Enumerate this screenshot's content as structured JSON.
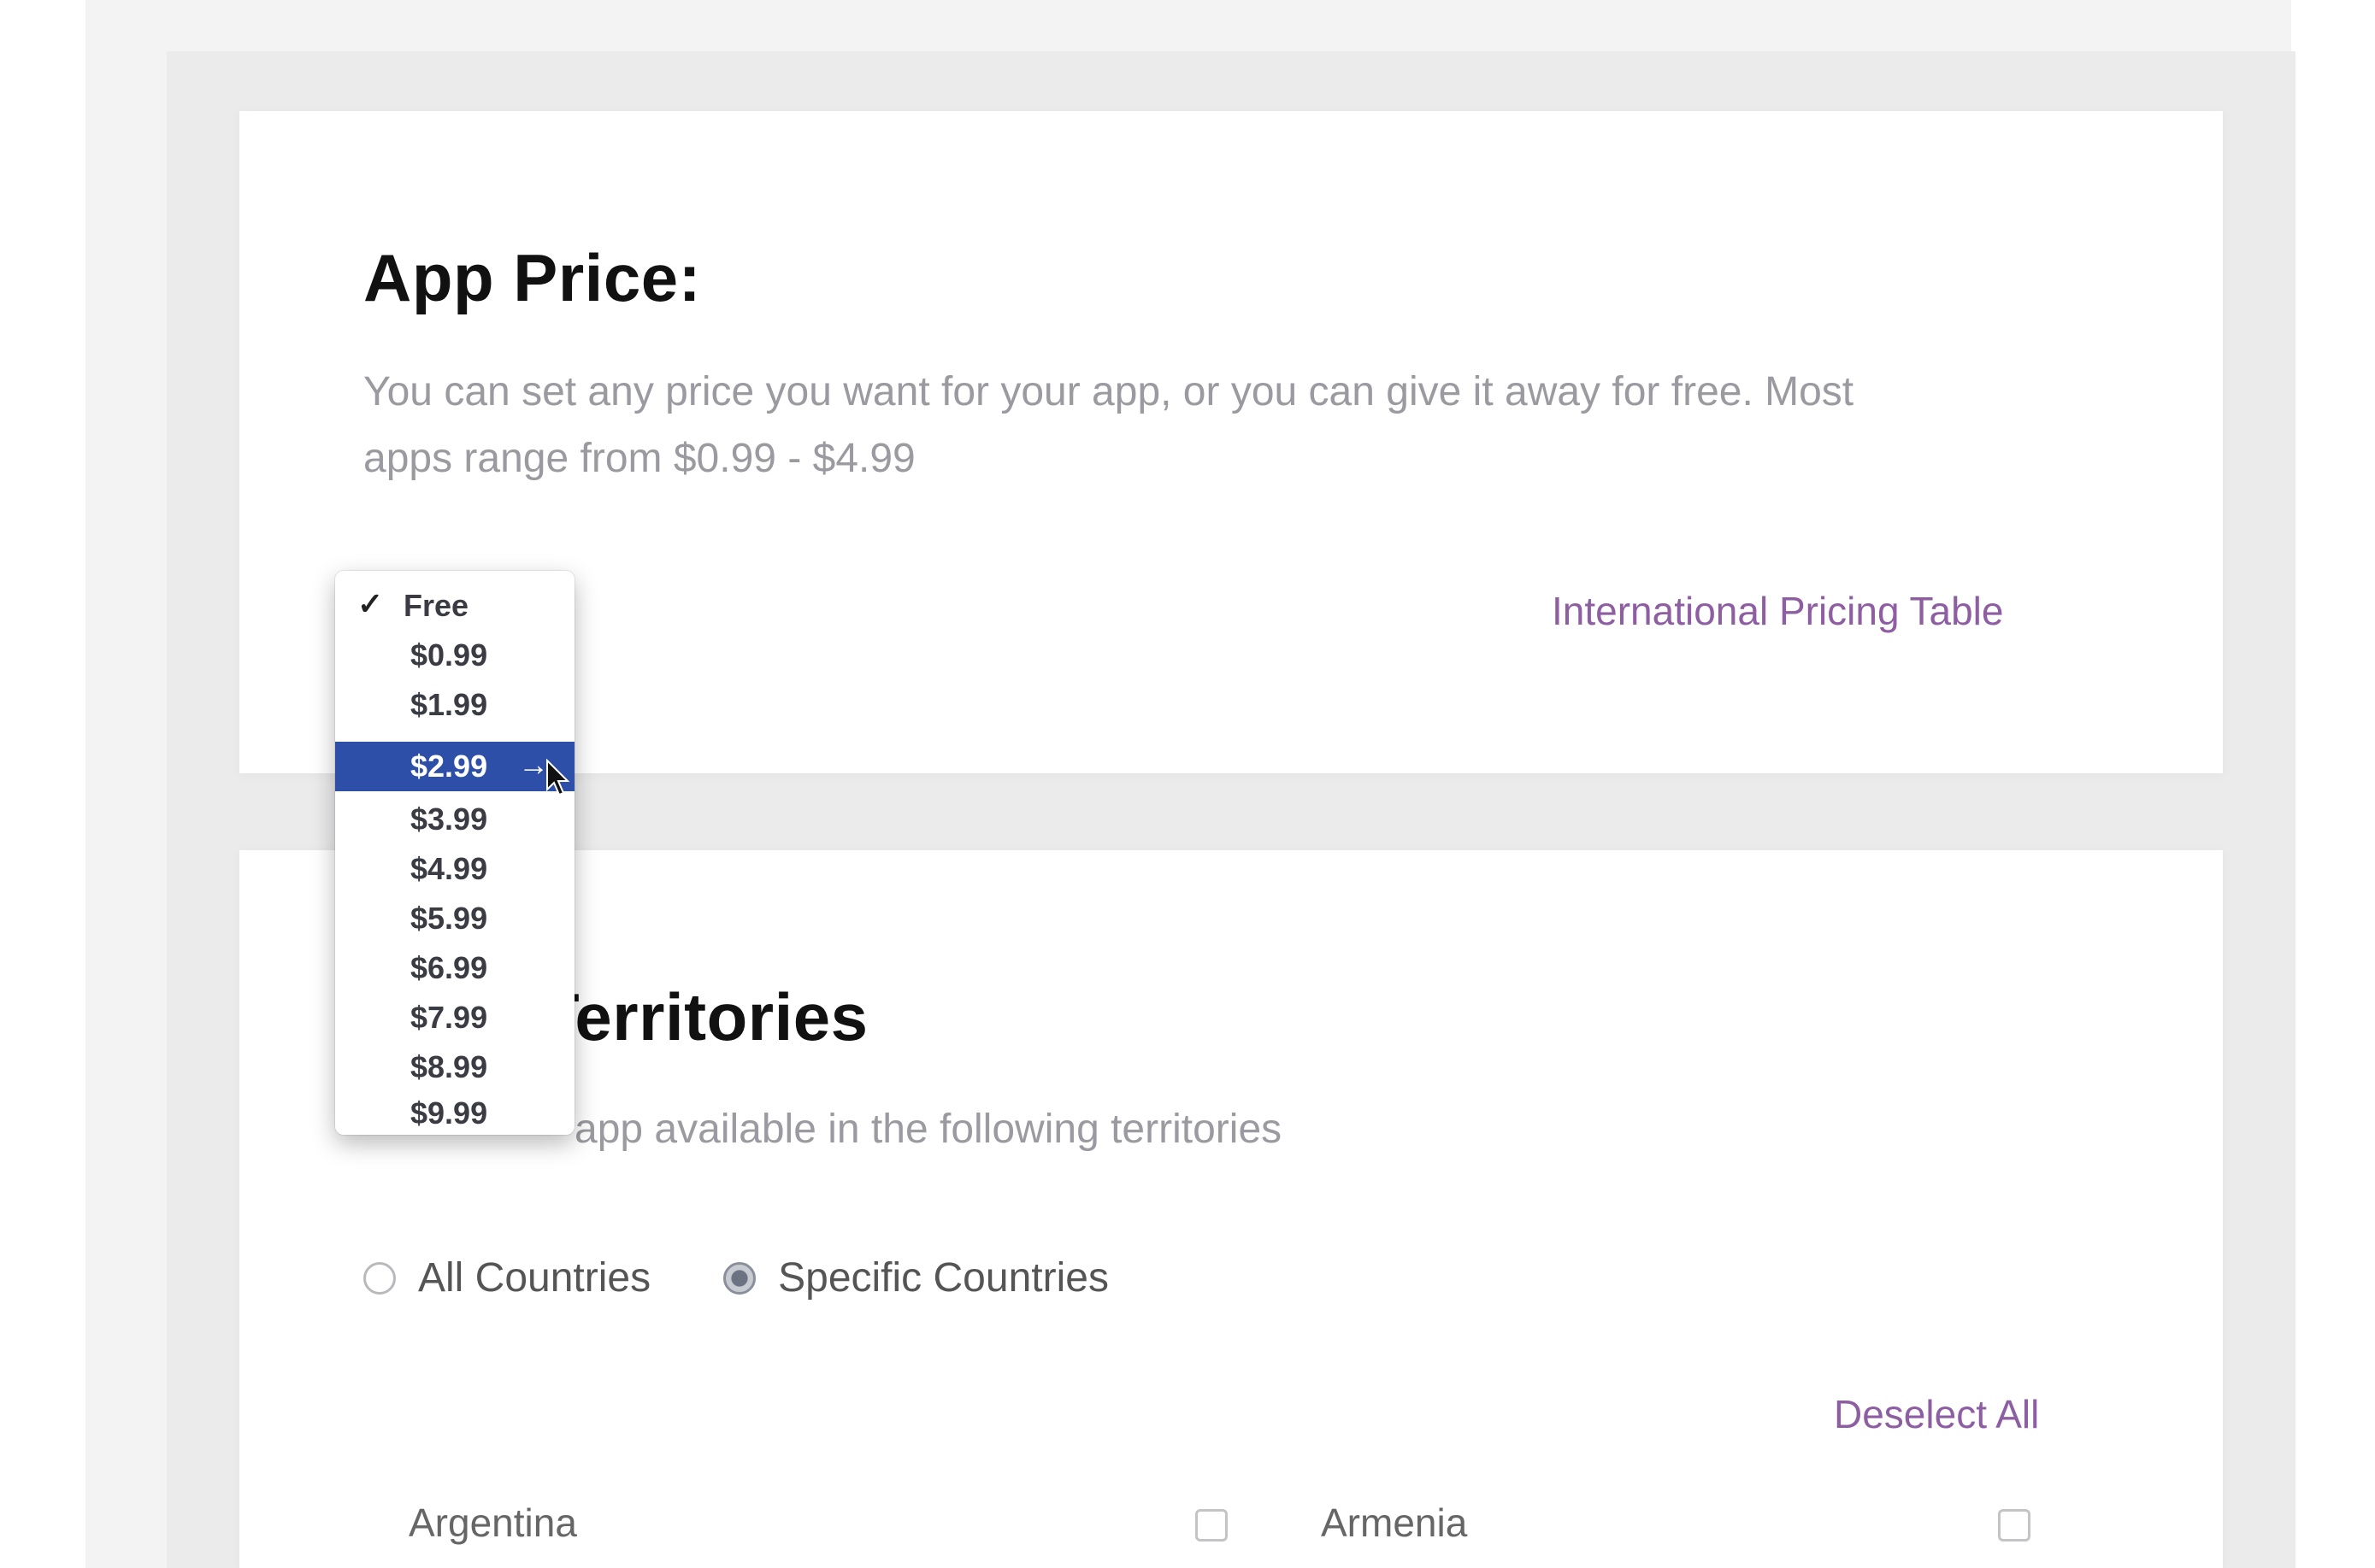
{
  "app_price": {
    "heading": "App Price:",
    "description_line1": "You can set any price you want for your app, or you can give it away for free. Most",
    "description_line2": "apps range from $0.99 - $4.99",
    "pricing_table_link": "International Pricing Table"
  },
  "price_dropdown": {
    "checked_value": "Free",
    "items": [
      {
        "label": "Free",
        "checked": true,
        "highlighted": false
      },
      {
        "label": "$0.99",
        "checked": false,
        "highlighted": false
      },
      {
        "label": "$1.99",
        "checked": false,
        "highlighted": false
      },
      {
        "label": "$2.99",
        "checked": false,
        "highlighted": true
      },
      {
        "label": "$3.99",
        "checked": false,
        "highlighted": false
      },
      {
        "label": "$4.99",
        "checked": false,
        "highlighted": false
      },
      {
        "label": "$5.99",
        "checked": false,
        "highlighted": false
      },
      {
        "label": "$6.99",
        "checked": false,
        "highlighted": false
      },
      {
        "label": "$7.99",
        "checked": false,
        "highlighted": false
      },
      {
        "label": "$8.99",
        "checked": false,
        "highlighted": false
      },
      {
        "label": "$9.99",
        "checked": false,
        "highlighted": false
      }
    ],
    "highlight_color": "#2d4fa8"
  },
  "territories": {
    "heading": "Territories",
    "description": "app available in the following territories",
    "radio_options": [
      {
        "label": "All Countries",
        "selected": false
      },
      {
        "label": "Specific Countries",
        "selected": true
      }
    ],
    "deselect_all_link": "Deselect All",
    "countries": [
      {
        "name": "Argentina",
        "checked": false
      },
      {
        "name": "Armenia",
        "checked": false
      }
    ]
  },
  "colors": {
    "link": "#8e5ea2",
    "heading": "#111111",
    "muted_text": "#9a9aa0"
  }
}
